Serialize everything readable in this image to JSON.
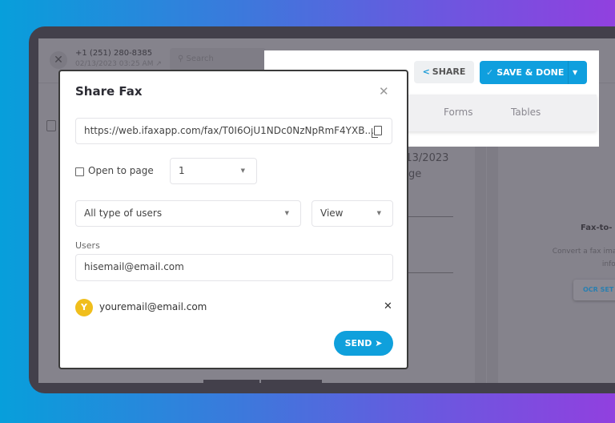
{
  "background_app": {
    "phone_number": "+1 (251) 280-8385",
    "datetime": "02/13/2023 03:25 AM",
    "search_placeholder": "Search",
    "document_date_fragment": "/13/2023",
    "document_page_fragment": "age",
    "ocr_panel": {
      "title_fragment": "Fax-to-",
      "description_line1": "Convert a fax imag",
      "description_line2": "inforr",
      "button_fragment": "OCR SET"
    }
  },
  "toolbar": {
    "share_label": "SHARE",
    "save_done_label": "SAVE & DONE",
    "tabs": [
      {
        "label": "Forms"
      },
      {
        "label": "Tables"
      }
    ],
    "accent_color": "#0f9fde"
  },
  "modal": {
    "title": "Share Fax",
    "url_value": "https://web.ifaxapp.com/fax/T0I6OjU1NDc0NzNpRmF4YXB...",
    "open_to_page_label": "Open to page",
    "open_to_page_checked": false,
    "page_select_value": "1",
    "user_type_select_value": "All type of users",
    "permission_select_value": "View",
    "users_label": "Users",
    "users_input_value": "hisemail@email.com",
    "shared_users": [
      {
        "initial": "Y",
        "email": "youremail@email.com",
        "avatar_color": "#f0be1c"
      }
    ],
    "send_label": "SEND"
  }
}
